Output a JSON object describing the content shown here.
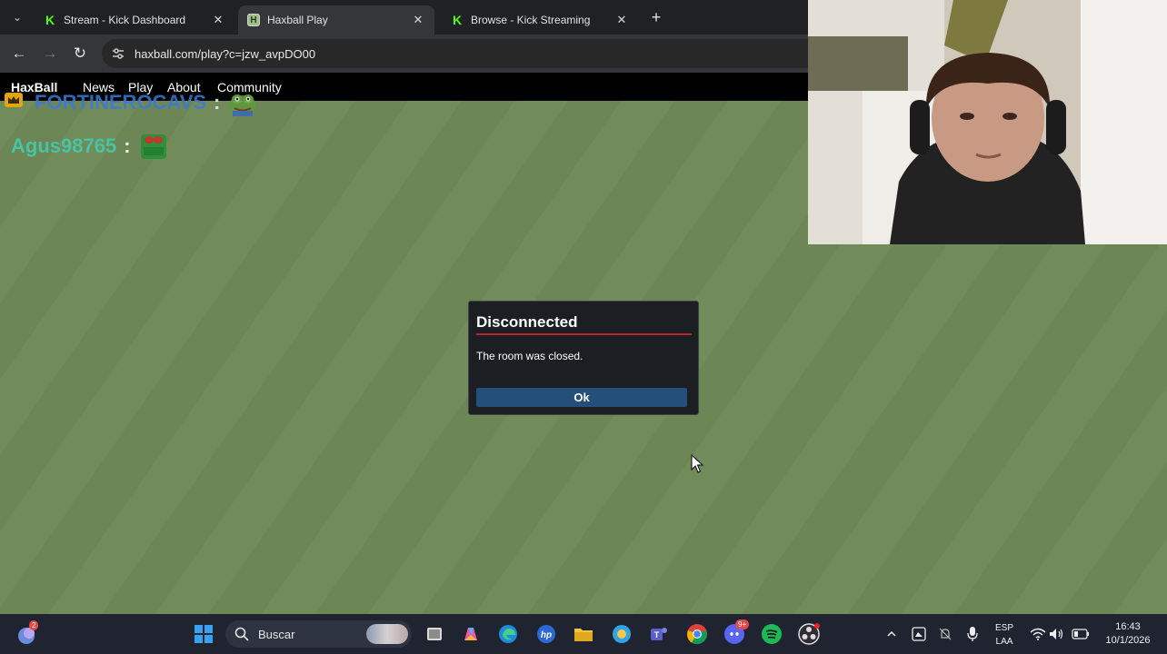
{
  "browser": {
    "tabs": [
      {
        "title": "Stream - Kick Dashboard",
        "favicon": "kick-icon",
        "active": false
      },
      {
        "title": "Haxball Play",
        "favicon": "haxball-icon",
        "active": true
      },
      {
        "title": "Browse - Kick Streaming",
        "favicon": "kick-icon",
        "active": false
      }
    ],
    "url": "haxball.com/play?c=jzw_avpDO00"
  },
  "haxball_nav": {
    "brand": "HaxBall",
    "links": [
      "News",
      "Play",
      "About",
      "Community"
    ]
  },
  "chat": [
    {
      "name": "FORTINEROCAVS",
      "sep": ":",
      "color": "#3a7bd5"
    },
    {
      "name": "Agus98765",
      "sep": ":",
      "color": "#48c4a4"
    }
  ],
  "dialog": {
    "title": "Disconnected",
    "message": "The room was closed.",
    "ok_label": "Ok",
    "accent": "#c2222c"
  },
  "taskbar": {
    "search_placeholder": "Buscar",
    "notification_badge": "2",
    "discord_badge": "9+",
    "language": "ESP",
    "layout": "LAA",
    "time": "16:43",
    "date": "10/1/2026"
  }
}
